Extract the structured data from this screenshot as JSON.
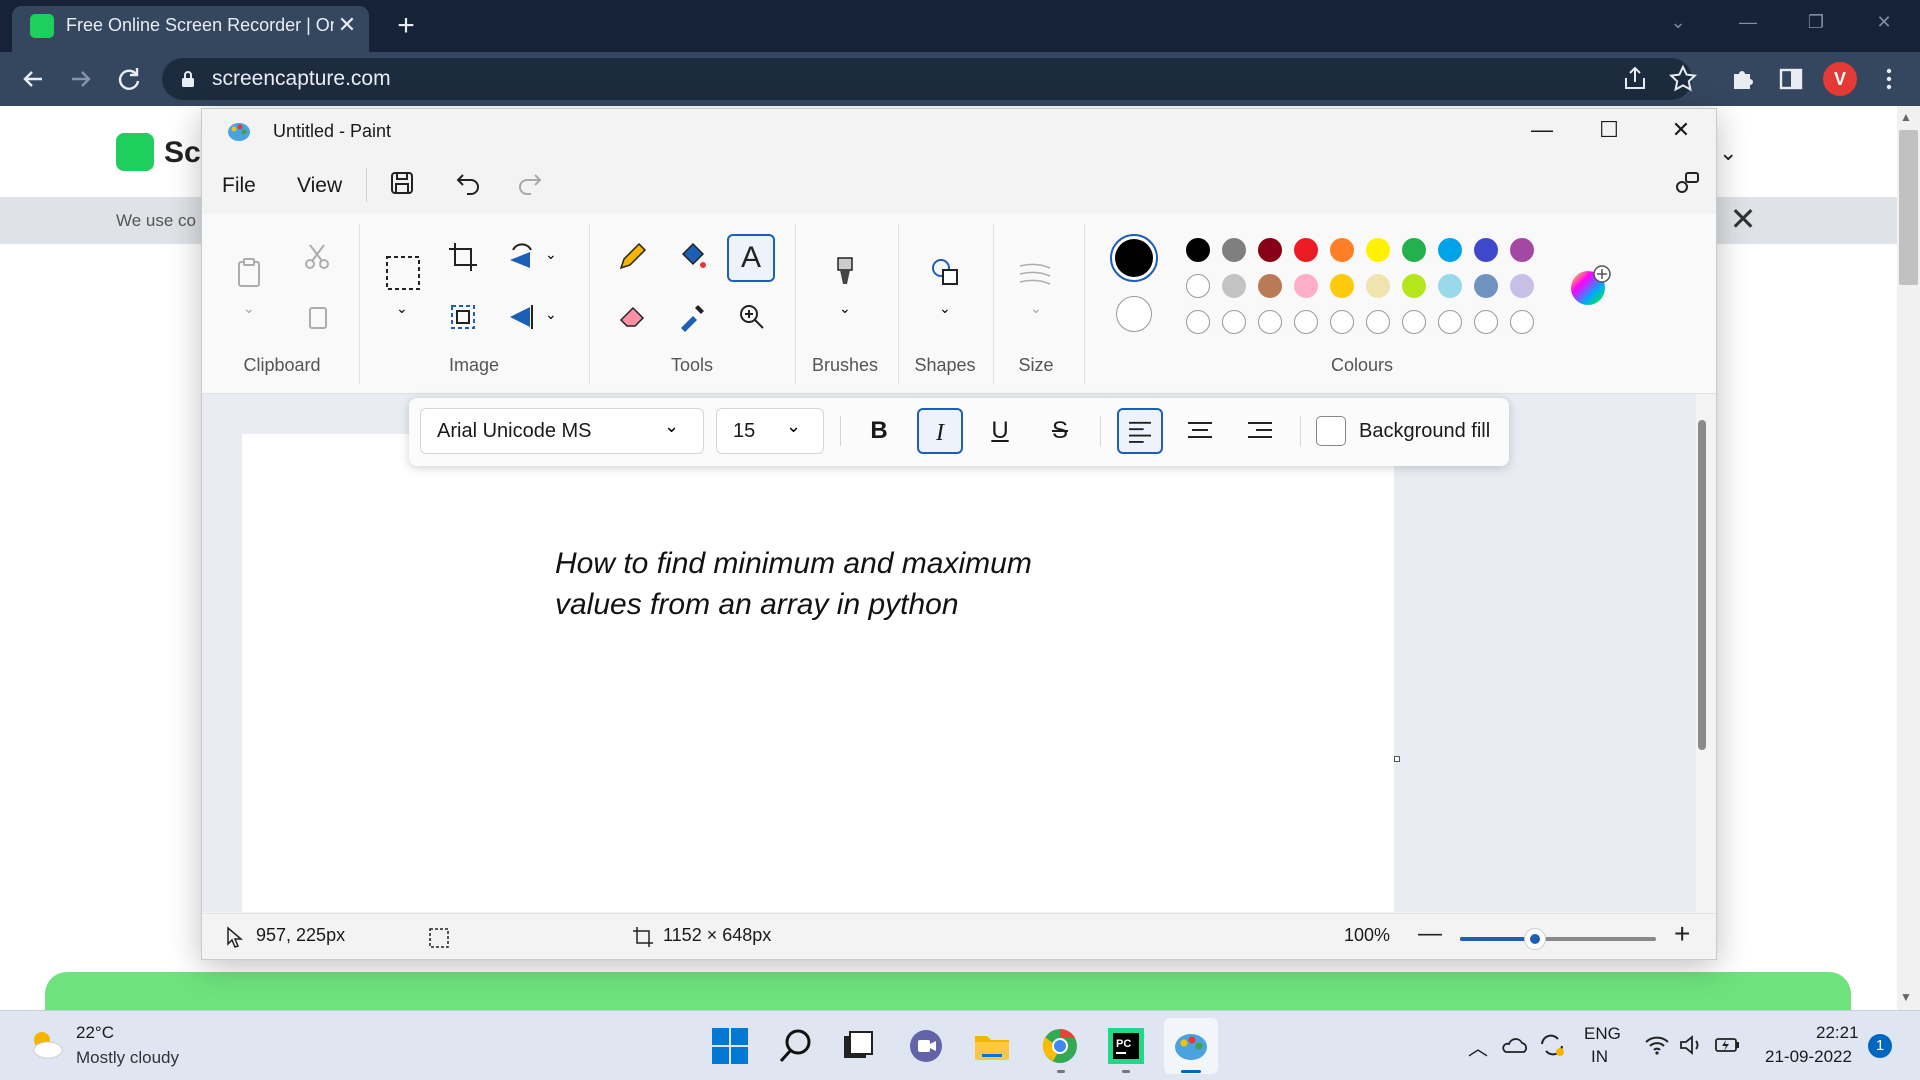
{
  "browser": {
    "tab_title": "Free Online Screen Recorder | Online",
    "url": "screencapture.com",
    "tab_close": "✕",
    "new_tab": "+"
  },
  "page": {
    "logo_text": "Sc",
    "cookie_text": "We use co",
    "cookie_close": "✕",
    "nav_right": "l ⌄"
  },
  "paint": {
    "title": "Untitled - Paint",
    "menu": {
      "file": "File",
      "view": "View"
    },
    "groups": {
      "clipboard": "Clipboard",
      "image": "Image",
      "tools": "Tools",
      "brushes": "Brushes",
      "shapes": "Shapes",
      "size": "Size",
      "colours": "Colours"
    },
    "palette": {
      "row1": [
        "#000000",
        "#7f7f7f",
        "#880015",
        "#ed1c24",
        "#ff7f27",
        "#fff200",
        "#22b14c",
        "#00a2e8",
        "#3f48cc",
        "#a349a4"
      ],
      "row2": [
        "#ffffff",
        "#c3c3c3",
        "#b97a57",
        "#ffaec9",
        "#ffc90e",
        "#efe4b0",
        "#b5e61d",
        "#99d9ea",
        "#7092be",
        "#c8bfe7"
      ],
      "row3_empty": 10
    },
    "text_toolbar": {
      "font": "Arial Unicode MS",
      "size": "15",
      "bold": "B",
      "italic": "I",
      "underline": "U",
      "strike": "S",
      "background_fill": "Background fill"
    },
    "canvas_text_line1": "How to find minimum and maximum",
    "canvas_text_line2": "values from an array in python",
    "status": {
      "cursor": "957, 225px",
      "canvas_size": "1152 × 648px",
      "zoom": "100%",
      "zoom_level_percent": 100
    }
  },
  "taskbar": {
    "weather_temp": "22°C",
    "weather_desc": "Mostly cloudy",
    "lang1": "ENG",
    "lang2": "IN",
    "time": "22:21",
    "date": "21-09-2022",
    "notifications": "1"
  }
}
